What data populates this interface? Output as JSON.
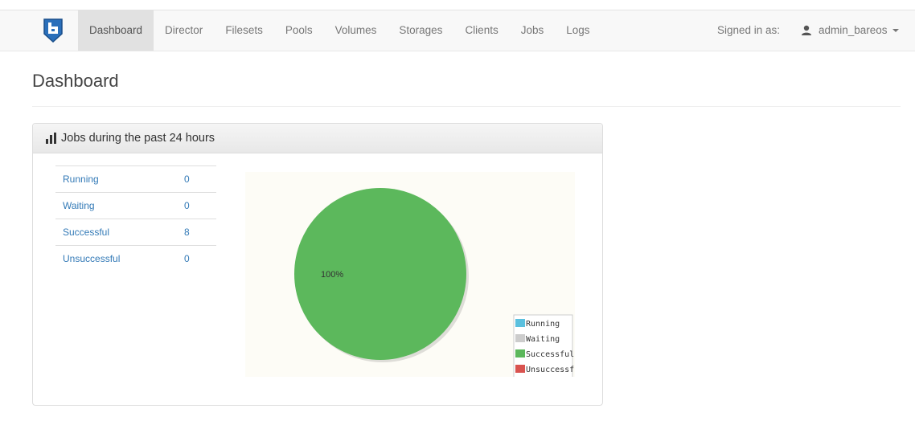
{
  "nav": {
    "items": [
      "Dashboard",
      "Director",
      "Filesets",
      "Pools",
      "Volumes",
      "Storages",
      "Clients",
      "Jobs",
      "Logs"
    ],
    "active": "Dashboard",
    "signed_in_label": "Signed in as:",
    "user": "admin_bareos"
  },
  "page": {
    "title": "Dashboard"
  },
  "panel": {
    "title": "Jobs during the past 24 hours",
    "rows": [
      {
        "label": "Running",
        "value": "0"
      },
      {
        "label": "Waiting",
        "value": "0"
      },
      {
        "label": "Successful",
        "value": "8"
      },
      {
        "label": "Unsuccessful",
        "value": "0"
      }
    ]
  },
  "chart_data": {
    "type": "pie",
    "categories": [
      "Running",
      "Waiting",
      "Successful",
      "Unsuccessful"
    ],
    "values": [
      0,
      0,
      8,
      0
    ],
    "slice_labels": [
      "",
      "",
      "100%",
      ""
    ],
    "colors": [
      "#5bc0de",
      "#cccccc",
      "#5cb85c",
      "#d9534f"
    ],
    "legend_position": "bottom-right"
  }
}
